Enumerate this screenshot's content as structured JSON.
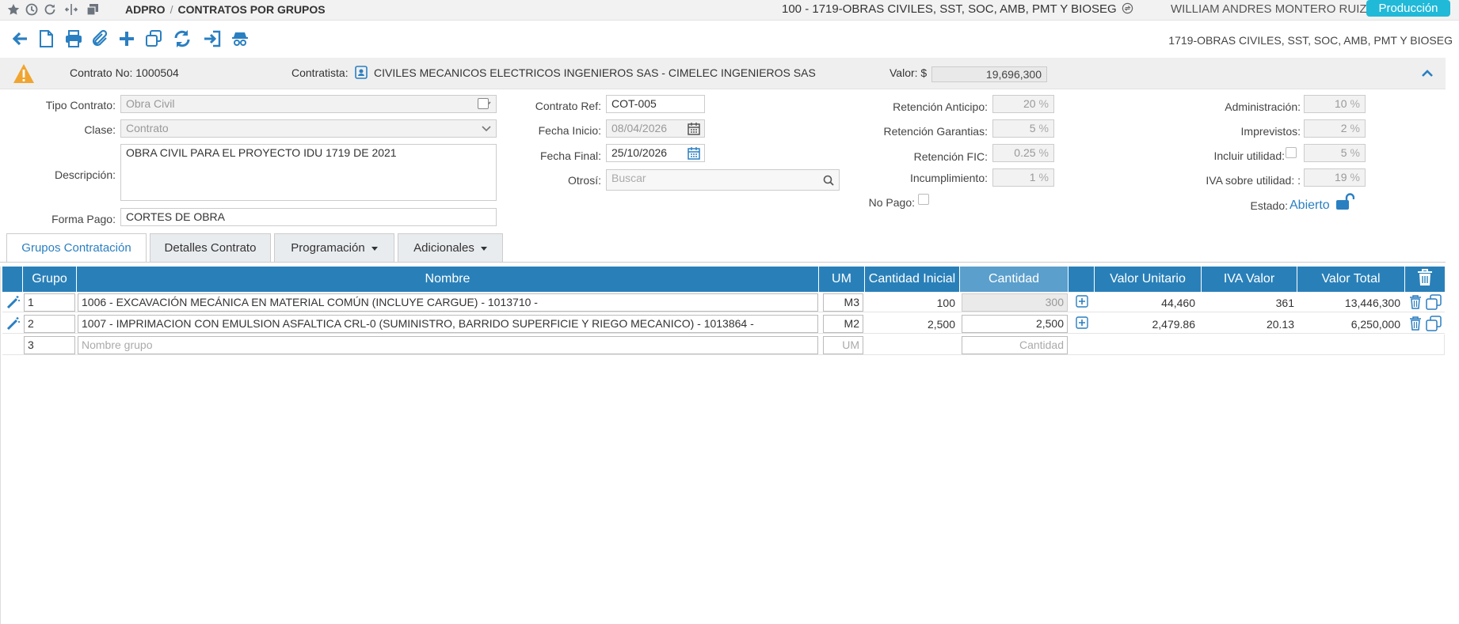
{
  "topbar": {
    "breadcrumb_root": "ADPRO",
    "breadcrumb_sep": "/",
    "breadcrumb_page": "CONTRATOS POR GRUPOS",
    "project_title": "100 - 1719-OBRAS CIVILES, SST, SOC, AMB, PMT Y BIOSEG",
    "user_name": "WILLIAM ANDRES MONTERO RUIZ",
    "environment": "Producción"
  },
  "toolbar": {
    "project_label": "1719-OBRAS CIVILES, SST, SOC, AMB, PMT Y BIOSEG"
  },
  "contract": {
    "numero_label": "Contrato No: 1000504",
    "contratista_label": "Contratista:",
    "contratista": "CIVILES MECANICOS ELECTRICOS INGENIEROS SAS - CIMELEC INGENIEROS SAS",
    "valor_label": "Valor: $",
    "valor": "19,696,300"
  },
  "form": {
    "tipo_contrato_label": "Tipo Contrato:",
    "tipo_contrato": "Obra Civil",
    "clase_label": "Clase:",
    "clase": "Contrato",
    "descripcion_label": "Descripción:",
    "descripcion": "OBRA CIVIL PARA EL PROYECTO IDU 1719 DE 2021",
    "forma_pago_label": "Forma Pago:",
    "forma_pago": "CORTES DE OBRA",
    "contrato_ref_label": "Contrato Ref:",
    "contrato_ref": "COT-005",
    "fecha_inicio_label": "Fecha Inicio:",
    "fecha_inicio": "08/04/2026",
    "fecha_final_label": "Fecha Final:",
    "fecha_final": "25/10/2026",
    "otrosi_label": "Otrosí:",
    "otrosi_placeholder": "Buscar",
    "no_pago_label": "No Pago:",
    "retencion_anticipo_label": "Retención Anticipo:",
    "retencion_anticipo": "20",
    "retencion_garantias_label": "Retención Garantias:",
    "retencion_garantias": "5",
    "retencion_fic_label": "Retención FIC:",
    "retencion_fic": "0.25",
    "incumplimiento_label": "Incumplimiento:",
    "incumplimiento": "1",
    "administracion_label": "Administración:",
    "administracion": "10",
    "imprevistos_label": "Imprevistos:",
    "imprevistos": "2",
    "incluir_utilidad_label": "Incluir utilidad:",
    "incluir_utilidad": "5",
    "iva_utilidad_label": "IVA sobre utilidad: :",
    "iva_utilidad": "19",
    "estado_label": "Estado:",
    "estado": "Abierto",
    "pct": "%"
  },
  "tabs": [
    {
      "label": "Grupos Contratación"
    },
    {
      "label": "Detalles Contrato"
    },
    {
      "label": "Programación"
    },
    {
      "label": "Adicionales"
    }
  ],
  "table": {
    "headers": {
      "grupo": "Grupo",
      "nombre": "Nombre",
      "um": "UM",
      "cantidad_inicial": "Cantidad Inicial",
      "cantidad": "Cantidad",
      "valor_unitario": "Valor Unitario",
      "iva_valor": "IVA Valor",
      "valor_total": "Valor Total"
    },
    "rows": [
      {
        "grupo": "1",
        "nombre": "1006 - EXCAVACIÓN MECÁNICA EN MATERIAL COMÚN (INCLUYE CARGUE) - 1013710 -",
        "um": "M3",
        "cantidad_inicial": "100",
        "cantidad": "300",
        "valor_unitario": "44,460",
        "iva_valor": "361",
        "valor_total": "13,446,300"
      },
      {
        "grupo": "2",
        "nombre": "1007 - IMPRIMACION CON EMULSION ASFALTICA CRL-0 (SUMINISTRO, BARRIDO SUPERFICIE Y RIEGO MECANICO) - 1013864 -",
        "um": "M2",
        "cantidad_inicial": "2,500",
        "cantidad": "2,500",
        "valor_unitario": "2,479.86",
        "iva_valor": "20.13",
        "valor_total": "6,250,000"
      }
    ],
    "new_row": {
      "grupo": "3",
      "nombre_placeholder": "Nombre grupo",
      "um_placeholder": "UM",
      "cantidad_placeholder": "Cantidad"
    }
  },
  "colors": {
    "accent": "#2a7fc1",
    "header_bg": "#2980b9",
    "badge": "#21b9d8"
  }
}
